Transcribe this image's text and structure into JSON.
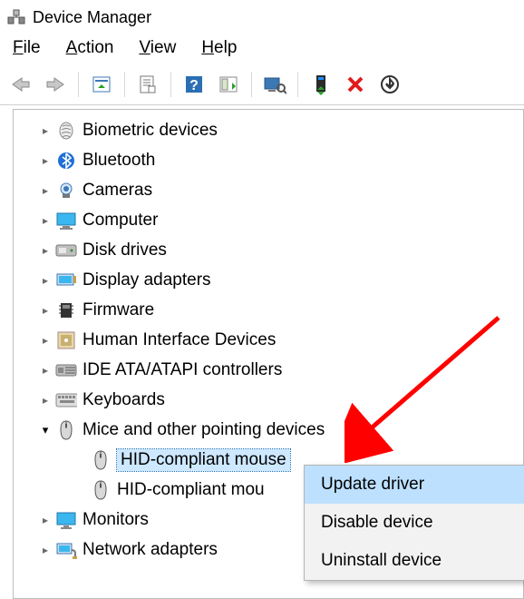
{
  "window": {
    "title": "Device Manager"
  },
  "menubar": {
    "items": [
      "File",
      "Action",
      "View",
      "Help"
    ]
  },
  "toolbar": {
    "buttons": [
      "back-icon",
      "forward-icon",
      "||",
      "show-hidden-icon",
      "||",
      "properties-icon",
      "||",
      "help-icon",
      "action-panel-icon",
      "||",
      "scan-hardware-icon",
      "||",
      "update-driver-icon",
      "uninstall-icon",
      "enable-icon"
    ]
  },
  "tree": {
    "nodes": [
      {
        "label": "Biometric devices",
        "icon": "fingerprint-icon",
        "expanded": false
      },
      {
        "label": "Bluetooth",
        "icon": "bluetooth-icon",
        "expanded": false
      },
      {
        "label": "Cameras",
        "icon": "camera-icon",
        "expanded": false
      },
      {
        "label": "Computer",
        "icon": "computer-icon",
        "expanded": false
      },
      {
        "label": "Disk drives",
        "icon": "disk-icon",
        "expanded": false
      },
      {
        "label": "Display adapters",
        "icon": "display-adapter-icon",
        "expanded": false
      },
      {
        "label": "Firmware",
        "icon": "firmware-icon",
        "expanded": false
      },
      {
        "label": "Human Interface Devices",
        "icon": "hid-icon",
        "expanded": false
      },
      {
        "label": "IDE ATA/ATAPI controllers",
        "icon": "ide-icon",
        "expanded": false
      },
      {
        "label": "Keyboards",
        "icon": "keyboard-icon",
        "expanded": false
      },
      {
        "label": "Mice and other pointing devices",
        "icon": "mouse-icon",
        "expanded": true,
        "children": [
          {
            "label": "HID-compliant mouse",
            "icon": "mouse-icon",
            "selected": true
          },
          {
            "label": "HID-compliant mou",
            "icon": "mouse-icon",
            "selected": false
          }
        ]
      },
      {
        "label": "Monitors",
        "icon": "monitor-icon",
        "expanded": false
      },
      {
        "label": "Network adapters",
        "icon": "network-icon",
        "expanded": false
      }
    ]
  },
  "context_menu": {
    "items": [
      {
        "label": "Update driver",
        "hover": true
      },
      {
        "label": "Disable device",
        "hover": false
      },
      {
        "label": "Uninstall device",
        "hover": false
      }
    ]
  }
}
